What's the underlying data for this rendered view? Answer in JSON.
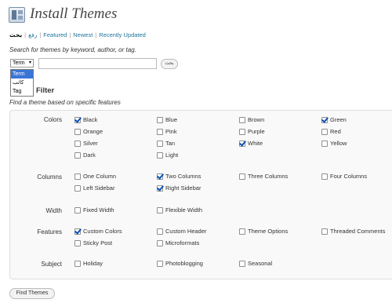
{
  "header": {
    "title": "Install Themes",
    "icon": "appearance-icon"
  },
  "subnav": [
    {
      "label": "بحث",
      "current": true
    },
    {
      "label": "رفع",
      "current": false
    },
    {
      "label": "Featured",
      "current": false
    },
    {
      "label": "Newest",
      "current": false
    },
    {
      "label": "Recently Updated",
      "current": false
    }
  ],
  "search": {
    "hint": "Search for themes by keyword, author, or tag.",
    "type_selected": "Term",
    "type_options": [
      "Term",
      "كاتب",
      "Tag"
    ],
    "input_value": "",
    "submit_label": "بحث"
  },
  "filter": {
    "heading": "Filter",
    "subheading": "Find a theme based on specific features",
    "groups": [
      {
        "label": "Colors",
        "options": [
          {
            "label": "Black",
            "checked": true
          },
          {
            "label": "Blue",
            "checked": false
          },
          {
            "label": "Brown",
            "checked": false
          },
          {
            "label": "Green",
            "checked": true
          },
          {
            "label": "Orange",
            "checked": false
          },
          {
            "label": "Pink",
            "checked": false
          },
          {
            "label": "Purple",
            "checked": false
          },
          {
            "label": "Red",
            "checked": false
          },
          {
            "label": "Silver",
            "checked": false
          },
          {
            "label": "Tan",
            "checked": false
          },
          {
            "label": "White",
            "checked": true
          },
          {
            "label": "Yellow",
            "checked": false
          },
          {
            "label": "Dark",
            "checked": false
          },
          {
            "label": "Light",
            "checked": false
          }
        ]
      },
      {
        "label": "Columns",
        "options": [
          {
            "label": "One Column",
            "checked": false
          },
          {
            "label": "Two Columns",
            "checked": true
          },
          {
            "label": "Three Columns",
            "checked": false
          },
          {
            "label": "Four Columns",
            "checked": false
          },
          {
            "label": "Left Sidebar",
            "checked": false
          },
          {
            "label": "Right Sidebar",
            "checked": true
          }
        ]
      },
      {
        "label": "Width",
        "options": [
          {
            "label": "Fixed Width",
            "checked": false
          },
          {
            "label": "Flexible Width",
            "checked": false
          }
        ]
      },
      {
        "label": "Features",
        "options": [
          {
            "label": "Custom Colors",
            "checked": true
          },
          {
            "label": "Custom Header",
            "checked": false
          },
          {
            "label": "Theme Options",
            "checked": false
          },
          {
            "label": "Threaded Comments",
            "checked": false
          },
          {
            "label": "Sticky Post",
            "checked": false
          },
          {
            "label": "Microformats",
            "checked": false
          }
        ]
      },
      {
        "label": "Subject",
        "options": [
          {
            "label": "Holiday",
            "checked": false
          },
          {
            "label": "Photoblogging",
            "checked": false
          },
          {
            "label": "Seasonal",
            "checked": false
          }
        ]
      }
    ]
  },
  "find_button_label": "Find Themes",
  "colors": {
    "link": "#21759b",
    "checkmark": "#0a4fb5",
    "panel_bg": "#f9f9f9"
  }
}
